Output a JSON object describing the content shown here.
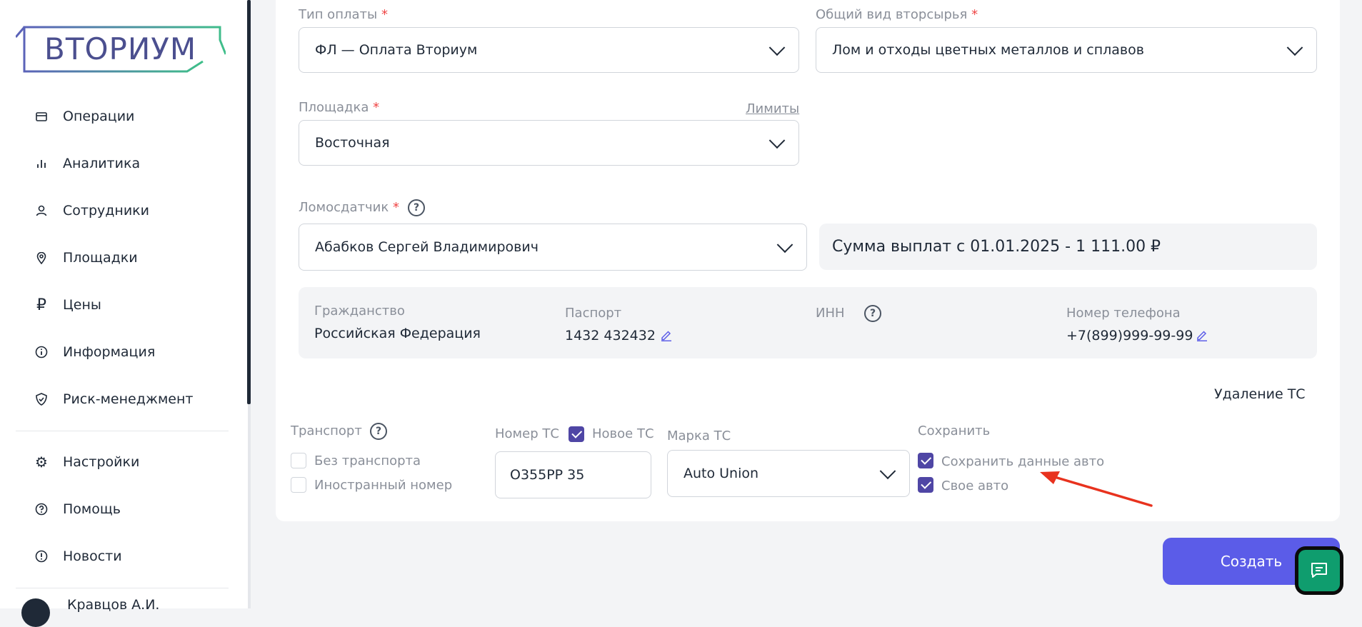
{
  "brand": {
    "logo_text": "ВТОРИУМ"
  },
  "sidebar": {
    "items": [
      {
        "label": "Операции",
        "icon": "card-icon"
      },
      {
        "label": "Аналитика",
        "icon": "bar-chart-icon"
      },
      {
        "label": "Сотрудники",
        "icon": "user-icon"
      },
      {
        "label": "Площадки",
        "icon": "location-pin-icon"
      },
      {
        "label": "Цены",
        "icon": "ruble-icon"
      },
      {
        "label": "Информация",
        "icon": "info-icon"
      },
      {
        "label": "Риск-менеджмент",
        "icon": "shield-check-icon"
      }
    ],
    "bottom_items": [
      {
        "label": "Настройки",
        "icon": "gear-icon"
      },
      {
        "label": "Помощь",
        "icon": "help-icon"
      },
      {
        "label": "Новости",
        "icon": "alert-icon"
      }
    ],
    "user_name": "Кравцов А.И."
  },
  "form": {
    "payment_type": {
      "label": "Тип оплаты",
      "required": "*",
      "value": "ФЛ — Оплата Вториум"
    },
    "material": {
      "label": "Общий вид вторсырья",
      "required": "*",
      "value": "Лом и отходы цветных металлов и сплавов"
    },
    "site": {
      "label": "Площадка",
      "required": "*",
      "value": "Восточная",
      "limits_link": "Лимиты"
    },
    "supplier": {
      "label": "Ломосдатчик",
      "required": "*",
      "value": "Абабков Сергей Владимирович"
    },
    "payout_summary": "Сумма выплат с 01.01.2025 - 1 111.00 ₽",
    "info": {
      "citizenship_label": "Гражданство",
      "citizenship_value": "Российская Федерация",
      "passport_label": "Паспорт",
      "passport_value": "1432 432432",
      "inn_label": "ИНН",
      "phone_label": "Номер телефона",
      "phone_value": "+7(899)999-99-99"
    },
    "delete_vehicle": "Удаление ТС",
    "transport": {
      "label": "Транспорт",
      "no_transport": {
        "label": "Без транспорта",
        "checked": false
      },
      "foreign_plate": {
        "label": "Иностранный номер",
        "checked": false
      }
    },
    "plate": {
      "label": "Номер ТС",
      "new_vehicle": {
        "label": "Новое ТС",
        "checked": true
      },
      "value": "О355РР 35"
    },
    "brand": {
      "label": "Марка ТС",
      "value": "Auto Union"
    },
    "save": {
      "label": "Сохранить",
      "save_car_data": {
        "label": "Сохранить данные авто",
        "checked": true
      },
      "own_car": {
        "label": "Свое авто",
        "checked": true
      }
    }
  },
  "actions": {
    "create_label": "Создать",
    "chat_icon": "chat-icon"
  },
  "colors": {
    "accent": "#5b5ce8",
    "checkbox": "#4f46a5",
    "required": "#ef4444",
    "annotation_arrow": "#e8321e",
    "chat": "#0f9d6e"
  }
}
